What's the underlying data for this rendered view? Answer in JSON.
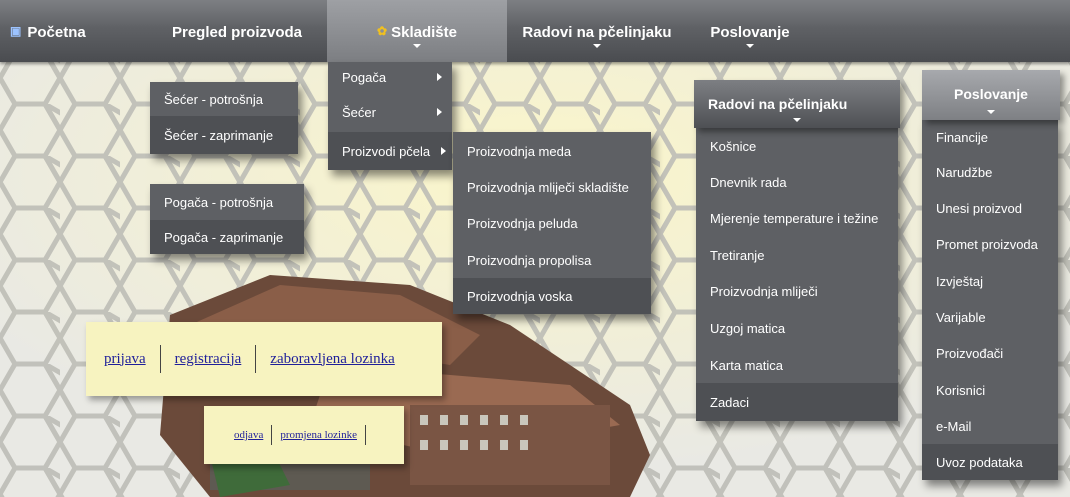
{
  "nav": {
    "home": "Početna",
    "overview": "Pregled proizvoda",
    "warehouse": "Skladište",
    "apiary_work": "Radovi na pčelinjaku",
    "business": "Poslovanje"
  },
  "sugar_menu": [
    "Šećer - potrošnja",
    "Šećer - zaprimanje"
  ],
  "pogaca_menu": [
    "Pogača - potrošnja",
    "Pogača - zaprimanje"
  ],
  "warehouse_menu": [
    "Pogača",
    "Šećer",
    "Proizvodi pčela"
  ],
  "bee_products_menu": [
    "Proizvodnja meda",
    "Proizvodnja mliječi skladište",
    "Proizvodnja peluda",
    "Proizvodnja propolisa",
    "Proizvodnja voska"
  ],
  "apiary_menu": {
    "title": "Radovi na pčelinjaku",
    "items": [
      "Košnice",
      "Dnevnik rada",
      "Mjerenje temperature i težine",
      "Tretiranje",
      "Proizvodnja mliječi",
      "Uzgoj matica",
      "Karta matica",
      "Zadaci"
    ]
  },
  "business_menu": {
    "title": "Poslovanje",
    "items": [
      "Financije",
      "Narudžbe",
      "Unesi proizvod",
      "Promet proizvoda",
      "Izvještaj",
      "Varijable",
      "Proizvođači",
      "Korisnici",
      "e-Mail",
      "Uvoz podataka"
    ]
  },
  "auth": {
    "login": "prijava",
    "register": "registracija",
    "forgot": "zaboravljena lozinka",
    "logout": "odjava",
    "change_password": "promjena lozinke"
  }
}
